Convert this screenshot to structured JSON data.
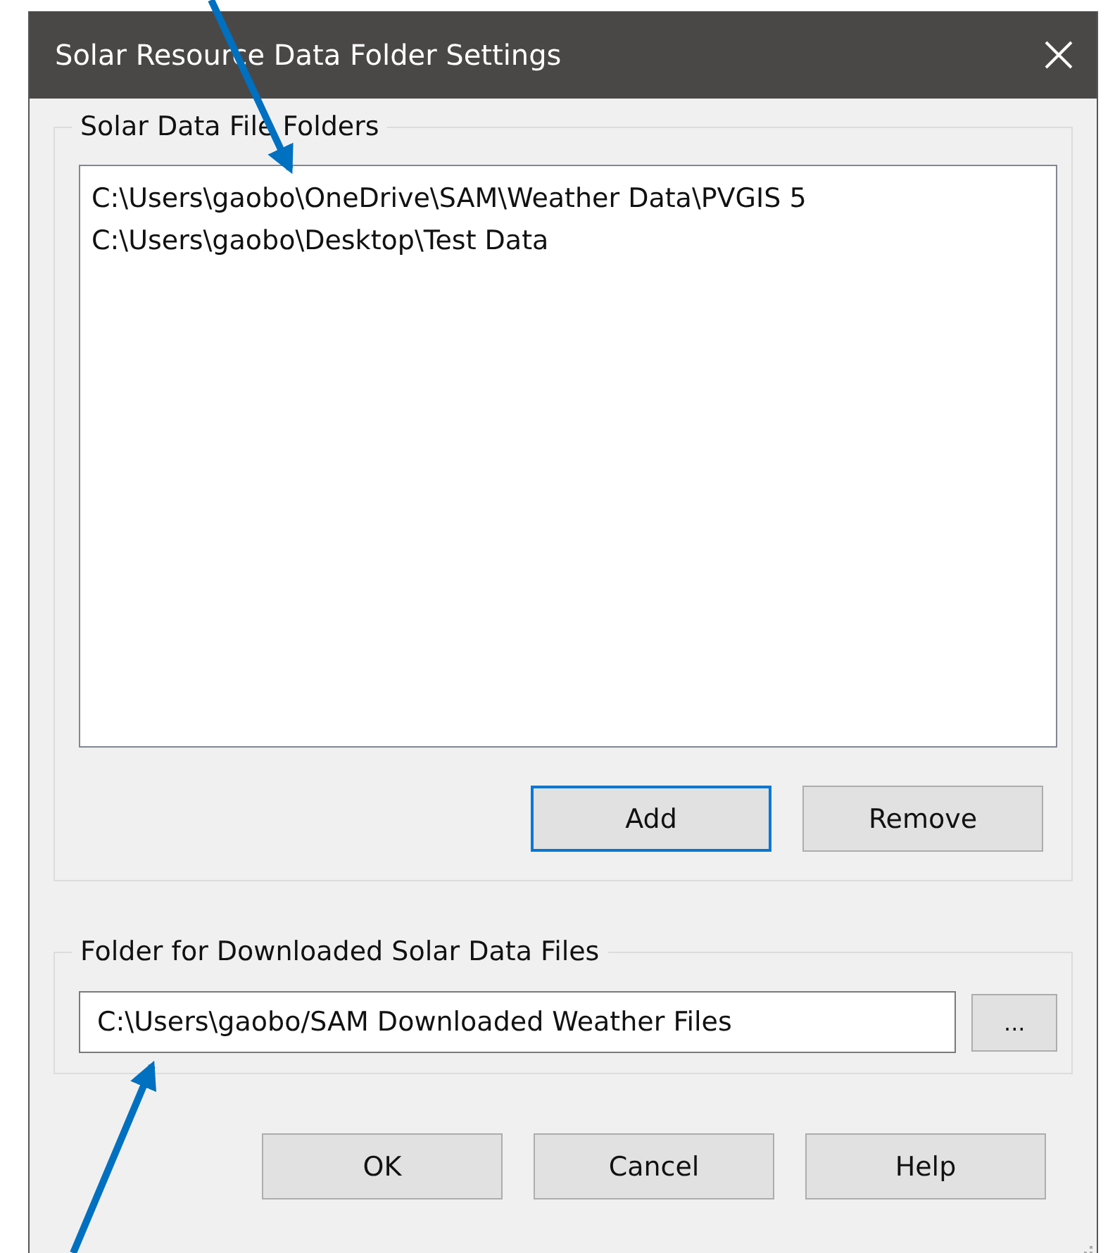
{
  "window": {
    "title": "Solar Resource Data Folder Settings"
  },
  "folders_group": {
    "label": "Solar Data File Folders",
    "items": [
      {
        "text": "C:\\Users\\gaobo\\OneDrive\\SAM\\Weather Data\\PVGIS 5",
        "selected": false
      },
      {
        "text": "C:\\Users\\gaobo\\Desktop\\Test Data",
        "selected": false
      }
    ],
    "buttons": [
      {
        "label": "Add",
        "focused": true
      },
      {
        "label": "Remove",
        "focused": false
      }
    ]
  },
  "download_group": {
    "label": "Folder for Downloaded Solar Data Files",
    "value": "C:\\Users\\gaobo/SAM Downloaded Weather Files",
    "browse": "..."
  },
  "buttons": [
    "OK",
    "Cancel",
    "Help"
  ]
}
